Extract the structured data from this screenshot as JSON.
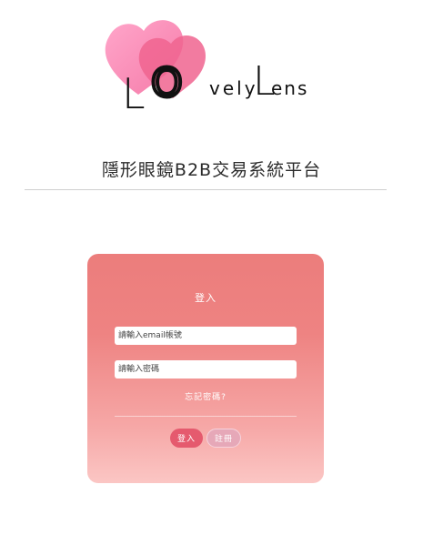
{
  "brand": {
    "letter_l": "L",
    "letter_o": "O",
    "word_rest": "vely",
    "letter_l2": "L",
    "word_end": "ens",
    "heart_colors": [
      "#ff8fb8",
      "#f5669a"
    ]
  },
  "site_title": "隱形眼鏡B2B交易系統平台",
  "login_card": {
    "title": "登入",
    "email_placeholder": "請輸入email帳號",
    "password_placeholder": "請輸入密碼",
    "forgot_password": "忘記密碼?",
    "login_button": "登入",
    "register_button": "註冊"
  },
  "colors": {
    "card_top": "#ec7d7c",
    "card_bottom": "#fbc6c4",
    "login_button": "#e55a6e",
    "register_button": "#e6a8b8"
  }
}
